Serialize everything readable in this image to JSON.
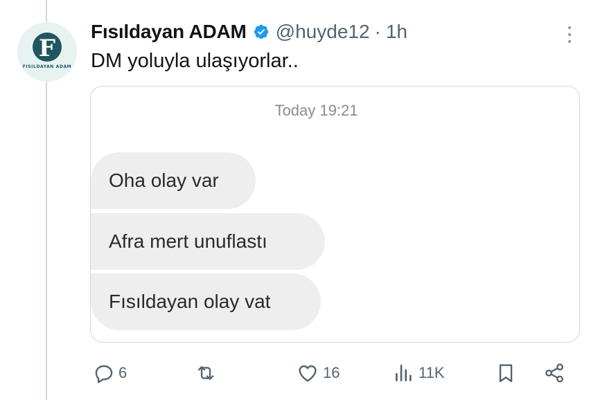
{
  "tweet": {
    "author": {
      "display_name": "Fısıldayan ADAM",
      "handle": "@huyde12",
      "avatar_letter": "F",
      "avatar_brand_text": "FISILDAYAN ADAM",
      "verified": true
    },
    "separator": "·",
    "time": "1h",
    "text": "DM yoluyla ulaşıyorlar..",
    "more_icon": "more-vertical-icon"
  },
  "dm": {
    "timestamp": "Today 19:21",
    "messages": [
      "Oha olay var",
      "Afra mert unuflastı",
      "Fısıldayan olay vat"
    ]
  },
  "actions": {
    "reply": {
      "icon": "reply-icon",
      "count": "6"
    },
    "retweet": {
      "icon": "retweet-icon",
      "count": ""
    },
    "like": {
      "icon": "heart-icon",
      "count": "16"
    },
    "views": {
      "icon": "views-icon",
      "count": "11K"
    },
    "bookmark": {
      "icon": "bookmark-icon"
    },
    "share": {
      "icon": "share-icon"
    }
  },
  "colors": {
    "text_primary": "#0f1419",
    "text_secondary": "#536471",
    "verified_blue": "#1d9bf0",
    "bubble_bg": "#eeeeee",
    "avatar_teal": "#1f5661",
    "border": "#cfd9de"
  }
}
